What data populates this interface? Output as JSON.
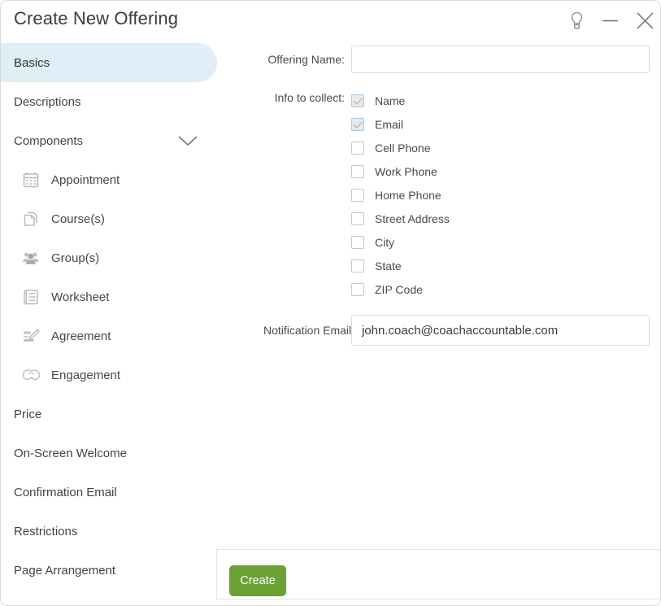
{
  "window": {
    "title": "Create New Offering",
    "controls": [
      {
        "name": "hint-lightbulb-icon",
        "glyph": "lightbulb"
      },
      {
        "name": "minimize-icon",
        "glyph": "minus"
      },
      {
        "name": "close-icon",
        "glyph": "x"
      }
    ]
  },
  "sidebar": {
    "items": [
      {
        "label": "Basics",
        "active": true
      },
      {
        "label": "Descriptions",
        "active": false
      },
      {
        "label": "Components",
        "active": false,
        "expandable": true,
        "chevron": "chevron-down-icon"
      }
    ],
    "components": [
      {
        "label": "Appointment",
        "icon": "calendar-icon"
      },
      {
        "label": "Course(s)",
        "icon": "documents-icon"
      },
      {
        "label": "Group(s)",
        "icon": "people-group-icon"
      },
      {
        "label": "Worksheet",
        "icon": "list-icon"
      },
      {
        "label": "Agreement",
        "icon": "signature-pen-icon"
      },
      {
        "label": "Engagement",
        "icon": "handshake-icon"
      }
    ],
    "items_after": [
      {
        "label": "Price"
      },
      {
        "label": "On-Screen Welcome"
      },
      {
        "label": "Confirmation Email"
      },
      {
        "label": "Restrictions"
      },
      {
        "label": "Page Arrangement"
      }
    ]
  },
  "form": {
    "offering_name": {
      "label": "Offering Name:",
      "value": "",
      "placeholder": ""
    },
    "info_to_collect": {
      "label": "Info to collect:",
      "options": [
        {
          "label": "Name",
          "checked": true,
          "locked": true
        },
        {
          "label": "Email",
          "checked": true,
          "locked": true
        },
        {
          "label": "Cell Phone",
          "checked": false,
          "locked": false
        },
        {
          "label": "Work Phone",
          "checked": false,
          "locked": false
        },
        {
          "label": "Home Phone",
          "checked": false,
          "locked": false
        },
        {
          "label": "Street Address",
          "checked": false,
          "locked": false
        },
        {
          "label": "City",
          "checked": false,
          "locked": false
        },
        {
          "label": "State",
          "checked": false,
          "locked": false
        },
        {
          "label": "ZIP Code",
          "checked": false,
          "locked": false
        }
      ]
    },
    "notification_email": {
      "label": "Notification Email(s):",
      "value": "john.coach@coachaccountable.com",
      "placeholder": ""
    }
  },
  "footer": {
    "create_label": "Create"
  },
  "colors": {
    "accent_green": "#6ba033",
    "active_nav_bg": "#dfeef7",
    "border": "#d9d9d9",
    "text": "#444444"
  }
}
